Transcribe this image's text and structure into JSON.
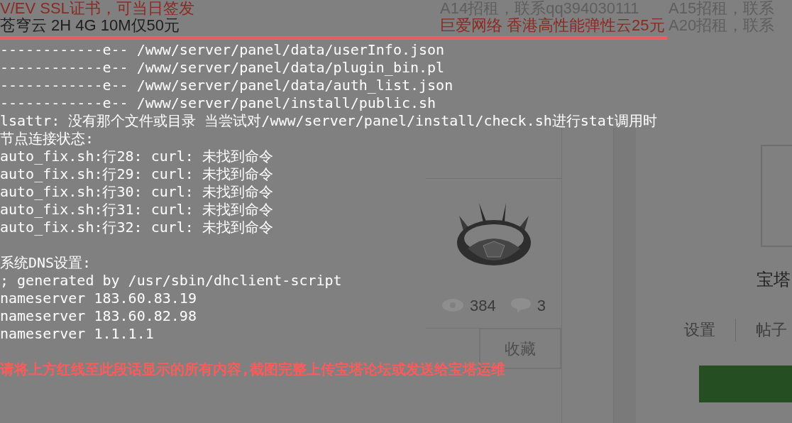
{
  "ads": [
    [
      {
        "text": "V/EV SSL证书，可当日签发",
        "kind": "highlight"
      },
      {
        "text": "A14招租，联系qq394030111",
        "kind": "plain"
      },
      {
        "text": "A15招租，联系",
        "kind": "plain"
      }
    ],
    [
      {
        "text": "苍穹云 2H 4G 10M仅50元",
        "kind": "dark"
      },
      {
        "text": "巨爱网络 香港高性能弹性云25元",
        "kind": "highlight"
      },
      {
        "text": "A20招租，联系",
        "kind": "plain"
      }
    ]
  ],
  "terminal": {
    "lines": [
      {
        "kind": "plain",
        "text": "------------e-- /www/server/panel/data/userInfo.json"
      },
      {
        "kind": "plain",
        "text": "------------e-- /www/server/panel/data/plugin_bin.pl"
      },
      {
        "kind": "plain",
        "text": "------------e-- /www/server/panel/data/auth_list.json"
      },
      {
        "kind": "plain",
        "text": "------------e-- /www/server/panel/install/public.sh"
      },
      {
        "kind": "plain",
        "text": "lsattr: 没有那个文件或目录 当尝试对/www/server/panel/install/check.sh进行stat调用时"
      },
      {
        "kind": "plain",
        "text": "节点连接状态:"
      },
      {
        "kind": "plain",
        "text": "auto_fix.sh:行28: curl: 未找到命令"
      },
      {
        "kind": "plain",
        "text": "auto_fix.sh:行29: curl: 未找到命令"
      },
      {
        "kind": "plain",
        "text": "auto_fix.sh:行30: curl: 未找到命令"
      },
      {
        "kind": "plain",
        "text": "auto_fix.sh:行31: curl: 未找到命令"
      },
      {
        "kind": "plain",
        "text": "auto_fix.sh:行32: curl: 未找到命令"
      },
      {
        "kind": "blank"
      },
      {
        "kind": "plain",
        "text": "系统DNS设置:"
      },
      {
        "kind": "plain",
        "text": "; generated by /usr/sbin/dhclient-script"
      },
      {
        "kind": "plain",
        "text": "nameserver 183.60.83.19"
      },
      {
        "kind": "plain",
        "text": "nameserver 183.60.82.98"
      },
      {
        "kind": "plain",
        "text": "nameserver 1.1.1.1"
      },
      {
        "kind": "blank"
      },
      {
        "kind": "warning",
        "text": "请将上方红线至此段话显示的所有内容,截图完整上传宝塔论坛或发送给宝塔运维"
      }
    ]
  },
  "card": {
    "views": "384",
    "comments": "3",
    "favorite_button": "收藏"
  },
  "profile": {
    "name": "宝塔",
    "links": [
      "设置",
      "帖子"
    ]
  }
}
